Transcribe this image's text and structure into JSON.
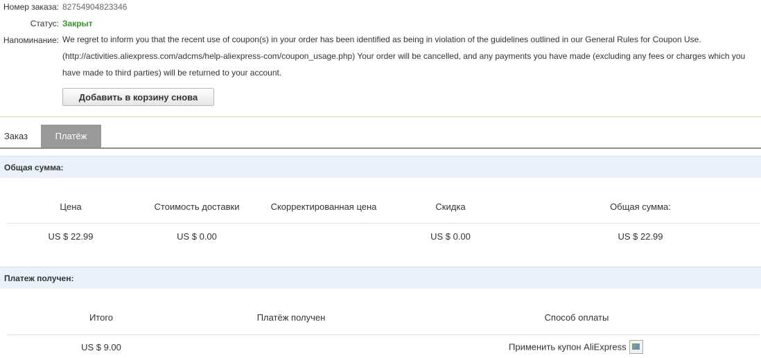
{
  "order": {
    "number_label": "Номер заказа:",
    "number_value": "82754904823346",
    "status_label": "Статус:",
    "status_value": "Закрыт",
    "reminder_label": "Напоминание:",
    "reminder_lines": [
      "We regret to inform you that the recent use of coupon(s) in your order has been identified as being in violation of the guidelines outlined in our General Rules for Coupon Use.",
      "(http://activities.aliexpress.com/adcms/help-aliexpress-com/coupon_usage.php) Your order will be cancelled, and any payments you have made (excluding any fees or charges which you",
      "have made to third parties) will be returned to your account."
    ],
    "reorder_button": "Добавить в корзину снова"
  },
  "tabs": {
    "order": "Заказ",
    "payment": "Платёж"
  },
  "total_section": {
    "title": "Общая сумма:",
    "headers": [
      "Цена",
      "Стоимость доставки",
      "Скорректированная цена",
      "Скидка",
      "Общая сумма:"
    ],
    "values": [
      "US $ 22.99",
      "US $ 0.00",
      "",
      "US $ 0.00",
      "US $ 22.99"
    ]
  },
  "payment_section": {
    "title": "Платеж получен:",
    "headers": [
      "Итого",
      "Платёж получен",
      "Способ оплаты"
    ],
    "values": [
      "US $ 9.00",
      "",
      "Применить купон AliExpress"
    ]
  },
  "colors": {
    "status_closed": "#2f9e1f",
    "section_bg": "#eaf1fb",
    "active_tab_bg": "#999999",
    "separator": "#e7d6a8"
  }
}
